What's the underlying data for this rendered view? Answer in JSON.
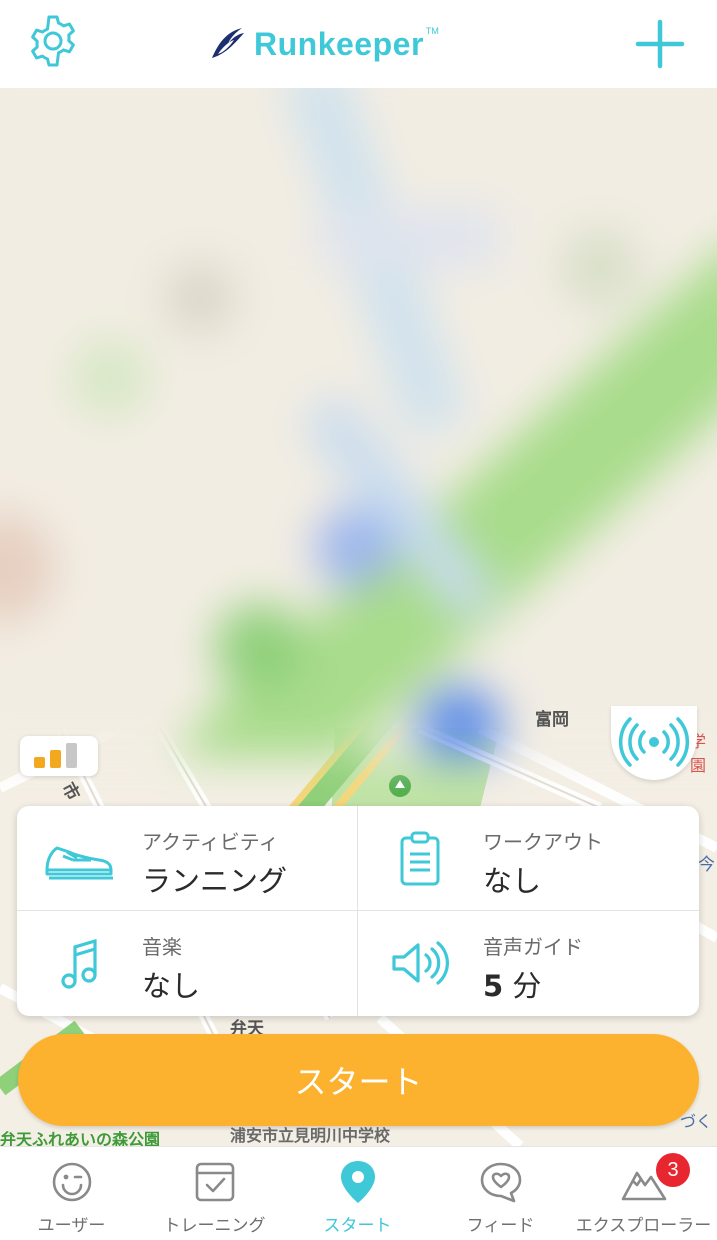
{
  "app": {
    "brand": "Runkeeper",
    "brand_tm": "TM"
  },
  "colors": {
    "accent": "#3ec8d8",
    "brand_navy": "#1d2f6f",
    "start": "#fdb22f",
    "badge": "#e8262f",
    "park": "#a8d98a"
  },
  "header": {
    "left_icon": "gear-icon",
    "right_icon": "plus-icon"
  },
  "map": {
    "labels": {
      "top_right": "学園",
      "top_mid": "富岡",
      "left_city": "市",
      "right_now": "今",
      "bentenn": "弁天",
      "park": "弁天ふれあいの森公園",
      "school": "浦安市立見明川中学校",
      "right_edge": "づく"
    }
  },
  "activity_settings": [
    {
      "key": "activity",
      "icon": "shoe-icon",
      "label": "アクティビティ",
      "value": "ランニング"
    },
    {
      "key": "workout",
      "icon": "clipboard-icon",
      "label": "ワークアウト",
      "value": "なし"
    },
    {
      "key": "music",
      "icon": "music-note-icon",
      "label": "音楽",
      "value": "なし"
    },
    {
      "key": "audio_cues",
      "icon": "speaker-icon",
      "label": "音声ガイド",
      "value_number": "5",
      "value_unit": "分"
    }
  ],
  "start_button": {
    "label": "スタート"
  },
  "tabs": [
    {
      "key": "user",
      "icon": "smiley-icon",
      "label": "ユーザー",
      "active": false
    },
    {
      "key": "training",
      "icon": "calendar-check-icon",
      "label": "トレーニング",
      "active": false
    },
    {
      "key": "start",
      "icon": "map-pin-icon",
      "label": "スタート",
      "active": true
    },
    {
      "key": "feed",
      "icon": "chat-heart-icon",
      "label": "フィード",
      "active": false
    },
    {
      "key": "explore",
      "icon": "mountain-icon",
      "label": "エクスプローラー",
      "active": false,
      "badge": "3"
    }
  ]
}
